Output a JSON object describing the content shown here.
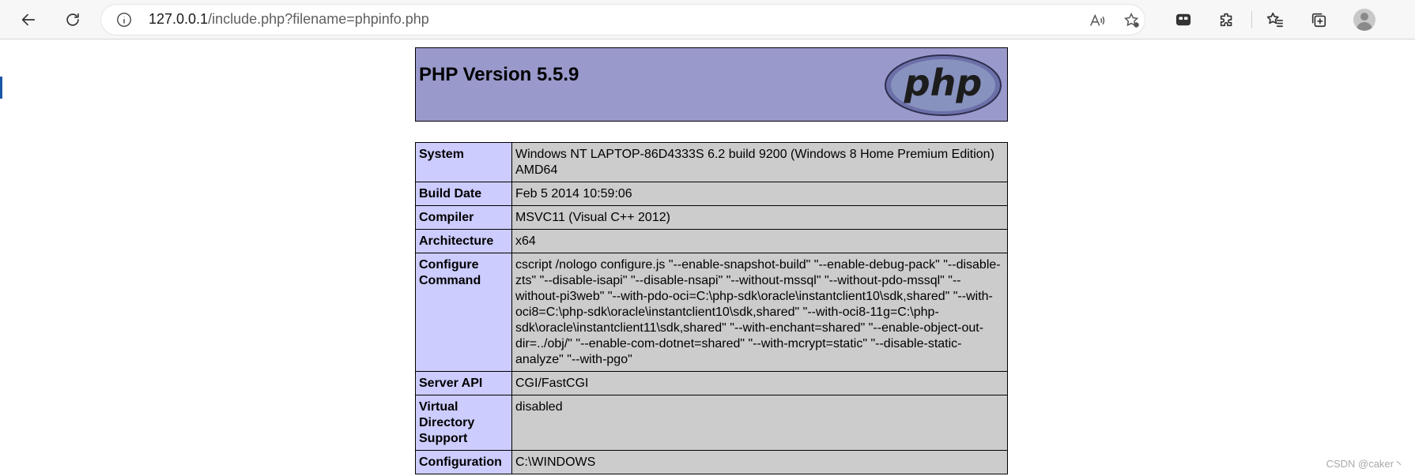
{
  "browser": {
    "url_host": "127.0.0.1",
    "url_path": "/include.php?filename=phpinfo.php",
    "icons": [
      "back-arrow-icon",
      "refresh-icon",
      "info-icon",
      "read-aloud-icon",
      "favorite-add-icon",
      "tab-actions-icon",
      "extensions-icon",
      "favorites-icon",
      "collections-icon",
      "profile-avatar-icon"
    ]
  },
  "phpinfo": {
    "title": "PHP Version 5.5.9",
    "logo_text": "php",
    "rows": [
      {
        "name": "System",
        "value": "Windows NT LAPTOP-86D4333S 6.2 build 9200 (Windows 8 Home Premium Edition) AMD64"
      },
      {
        "name": "Build Date",
        "value": "Feb 5 2014 10:59:06"
      },
      {
        "name": "Compiler",
        "value": "MSVC11 (Visual C++ 2012)"
      },
      {
        "name": "Architecture",
        "value": "x64"
      },
      {
        "name": "Configure Command",
        "value": "cscript /nologo configure.js \"--enable-snapshot-build\" \"--enable-debug-pack\" \"--disable-zts\" \"--disable-isapi\" \"--disable-nsapi\" \"--without-mssql\" \"--without-pdo-mssql\" \"--without-pi3web\" \"--with-pdo-oci=C:\\php-sdk\\oracle\\instantclient10\\sdk,shared\" \"--with-oci8=C:\\php-sdk\\oracle\\instantclient10\\sdk,shared\" \"--with-oci8-11g=C:\\php-sdk\\oracle\\instantclient11\\sdk,shared\" \"--with-enchant=shared\" \"--enable-object-out-dir=../obj/\" \"--enable-com-dotnet=shared\" \"--with-mcrypt=static\" \"--disable-static-analyze\" \"--with-pgo\""
      },
      {
        "name": "Server API",
        "value": "CGI/FastCGI"
      },
      {
        "name": "Virtual Directory Support",
        "value": "disabled"
      },
      {
        "name": "Configuration",
        "value": "C:\\WINDOWS"
      }
    ]
  },
  "watermark": "CSDN @caker丶",
  "colors": {
    "header_bg": "#9999cc",
    "key_bg": "#ccccff",
    "value_bg": "#cccccc"
  }
}
